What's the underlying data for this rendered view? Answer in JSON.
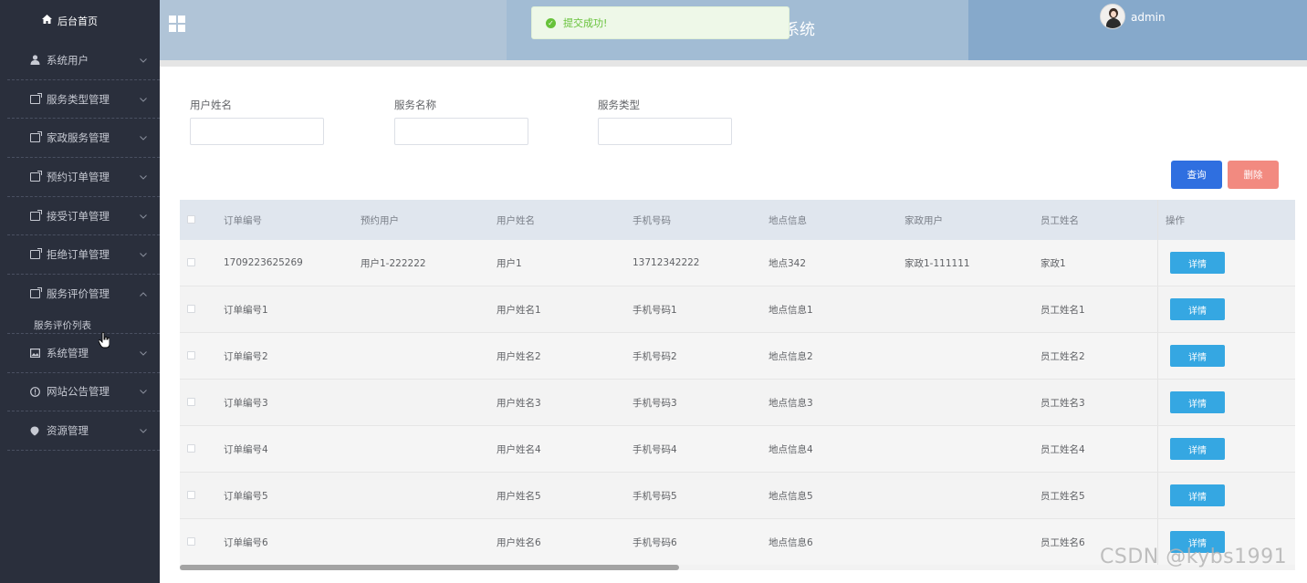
{
  "sidebar": {
    "home_label": "后台首页",
    "items": [
      {
        "label": "系统用户",
        "icon": "user-icon"
      },
      {
        "label": "服务类型管理",
        "icon": "edit-icon"
      },
      {
        "label": "家政服务管理",
        "icon": "edit-icon"
      },
      {
        "label": "预约订单管理",
        "icon": "edit-icon"
      },
      {
        "label": "接受订单管理",
        "icon": "edit-icon"
      },
      {
        "label": "拒绝订单管理",
        "icon": "edit-icon"
      },
      {
        "label": "服务评价管理",
        "icon": "edit-icon"
      },
      {
        "label": "系统管理",
        "icon": "picture-icon"
      },
      {
        "label": "网站公告管理",
        "icon": "info-icon"
      },
      {
        "label": "资源管理",
        "icon": "location-icon"
      }
    ],
    "submenu_label": "服务评价列表"
  },
  "header": {
    "title_visible": "系统",
    "user_name": "admin"
  },
  "toast": {
    "message": "提交成功!"
  },
  "search": {
    "fields": [
      {
        "label": "用户姓名",
        "value": ""
      },
      {
        "label": "服务名称",
        "value": ""
      },
      {
        "label": "服务类型",
        "value": ""
      }
    ],
    "query_label": "查询",
    "delete_label": "删除"
  },
  "table": {
    "columns": [
      "订单编号",
      "预约用户",
      "用户姓名",
      "手机号码",
      "地点信息",
      "家政用户",
      "员工姓名",
      "操作"
    ],
    "rows": [
      [
        "1709223625269",
        "用户1-222222",
        "用户1",
        "13712342222",
        "地点342",
        "家政1-111111",
        "家政1"
      ],
      [
        "订单编号1",
        "",
        "用户姓名1",
        "手机号码1",
        "地点信息1",
        "",
        "员工姓名1"
      ],
      [
        "订单编号2",
        "",
        "用户姓名2",
        "手机号码2",
        "地点信息2",
        "",
        "员工姓名2"
      ],
      [
        "订单编号3",
        "",
        "用户姓名3",
        "手机号码3",
        "地点信息3",
        "",
        "员工姓名3"
      ],
      [
        "订单编号4",
        "",
        "用户姓名4",
        "手机号码4",
        "地点信息4",
        "",
        "员工姓名4"
      ],
      [
        "订单编号5",
        "",
        "用户姓名5",
        "手机号码5",
        "地点信息5",
        "",
        "员工姓名5"
      ],
      [
        "订单编号6",
        "",
        "用户姓名6",
        "手机号码6",
        "地点信息6",
        "",
        "员工姓名6"
      ]
    ],
    "detail_label": "详情"
  },
  "watermark": "CSDN @kybs1991"
}
